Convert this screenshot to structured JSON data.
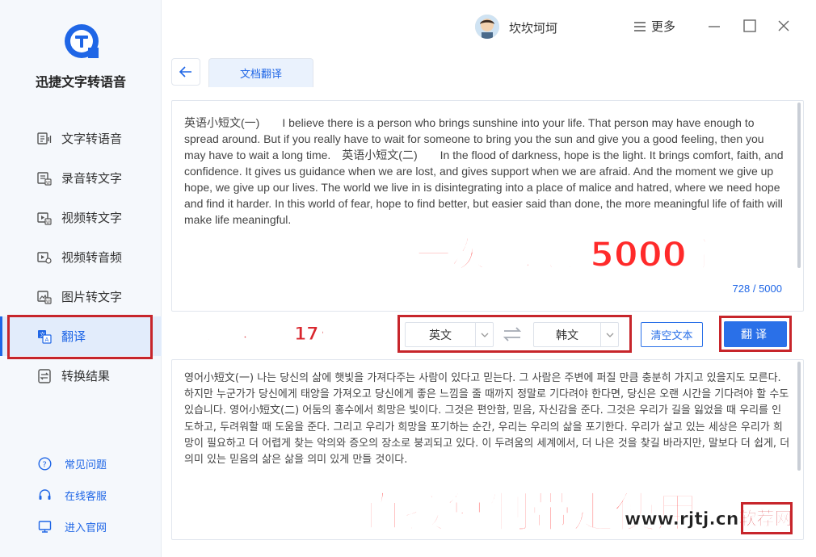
{
  "app": {
    "name": "迅捷文字转语音",
    "brand_color": "#1f66e6"
  },
  "titlebar": {
    "username": "坎坎坷坷",
    "more_label": "更多",
    "buttons": [
      "minimize-icon",
      "maximize-icon",
      "close-icon"
    ]
  },
  "sidebar": {
    "items": [
      {
        "label": "文字转语音",
        "icon": "text-to-speech-icon",
        "active": false
      },
      {
        "label": "录音转文字",
        "icon": "recording-to-text-icon",
        "active": false
      },
      {
        "label": "视频转文字",
        "icon": "video-to-text-icon",
        "active": false
      },
      {
        "label": "视频转音频",
        "icon": "video-to-audio-icon",
        "active": false
      },
      {
        "label": "图片转文字",
        "icon": "image-to-text-icon",
        "active": false
      },
      {
        "label": "翻译",
        "icon": "translate-icon",
        "active": true
      },
      {
        "label": "转换结果",
        "icon": "results-icon",
        "active": false
      }
    ],
    "footer": [
      {
        "label": "常见问题",
        "icon": "help-icon"
      },
      {
        "label": "在线客服",
        "icon": "headset-icon"
      },
      {
        "label": "进入官网",
        "icon": "monitor-icon"
      }
    ]
  },
  "tabs": {
    "active": "文档翻译"
  },
  "source": {
    "text": "英语小短文(一)　　I believe there is a person who brings sunshine into your life. That person may have enough to spread around. But if you really have to wait for someone to bring you the sun and give you a good feeling, then you may have to wait a long time.　英语小短文(二)　　In the flood of darkness, hope is the light. It brings comfort, faith, and confidence. It gives us guidance when we are lost, and gives support when we are afraid. And the moment we give up hope, we give up our lives. The world we live in is disintegrating into a place of malice and hatred, where we need hope and find it harder. In this world of fear, hope to find better, but easier said than done, the more meaningful life of faith will make life meaningful.",
    "counter": "728 / 5000"
  },
  "controls": {
    "source_lang": "英文",
    "target_lang": "韩文",
    "clear_label": "清空文本",
    "translate_label": "翻译"
  },
  "result": {
    "text": "영어小短文(一) 나는 당신의 삶에 햇빛을 가져다주는 사람이 있다고 믿는다. 그 사람은 주변에 퍼질 만큼 충분히 가지고 있을지도 모른다. 하지만 누군가가 당신에게 태양을 가져오고 당신에게 좋은 느낌을 줄 때까지 정말로 기다려야 한다면, 당신은 오랜 시간을 기다려야 할 수도 있습니다. 영어小短文(二) 어둠의 홍수에서 희망은 빛이다. 그것은 편안함, 믿음, 자신감을 준다. 그것은 우리가 길을 잃었을 때 우리를 인도하고, 두려워할 때 도움을 준다. 그리고 우리가 희망을 포기하는 순간, 우리는 우리의 삶을 포기한다. 우리가 살고 있는 세상은 우리가 희망이 필요하고 더 어렵게 찾는 악의와 증오의 장소로 붕괴되고 있다. 이 두려움의 세계에서, 더 나은 것을 찾길 바라지만, 말보다 더 쉽게, 더 의미 있는 믿음의 삶은 삶을 의미 있게 만들 것이다."
  },
  "annotations": {
    "chars_capacity": "一次性识别5000字",
    "languages": "转换语言，多达17种",
    "copy": "直接复制带走使用",
    "highlight_color": "#c7252b"
  },
  "watermark": {
    "site": "www.rjtj.cn",
    "label": "软荐网"
  }
}
